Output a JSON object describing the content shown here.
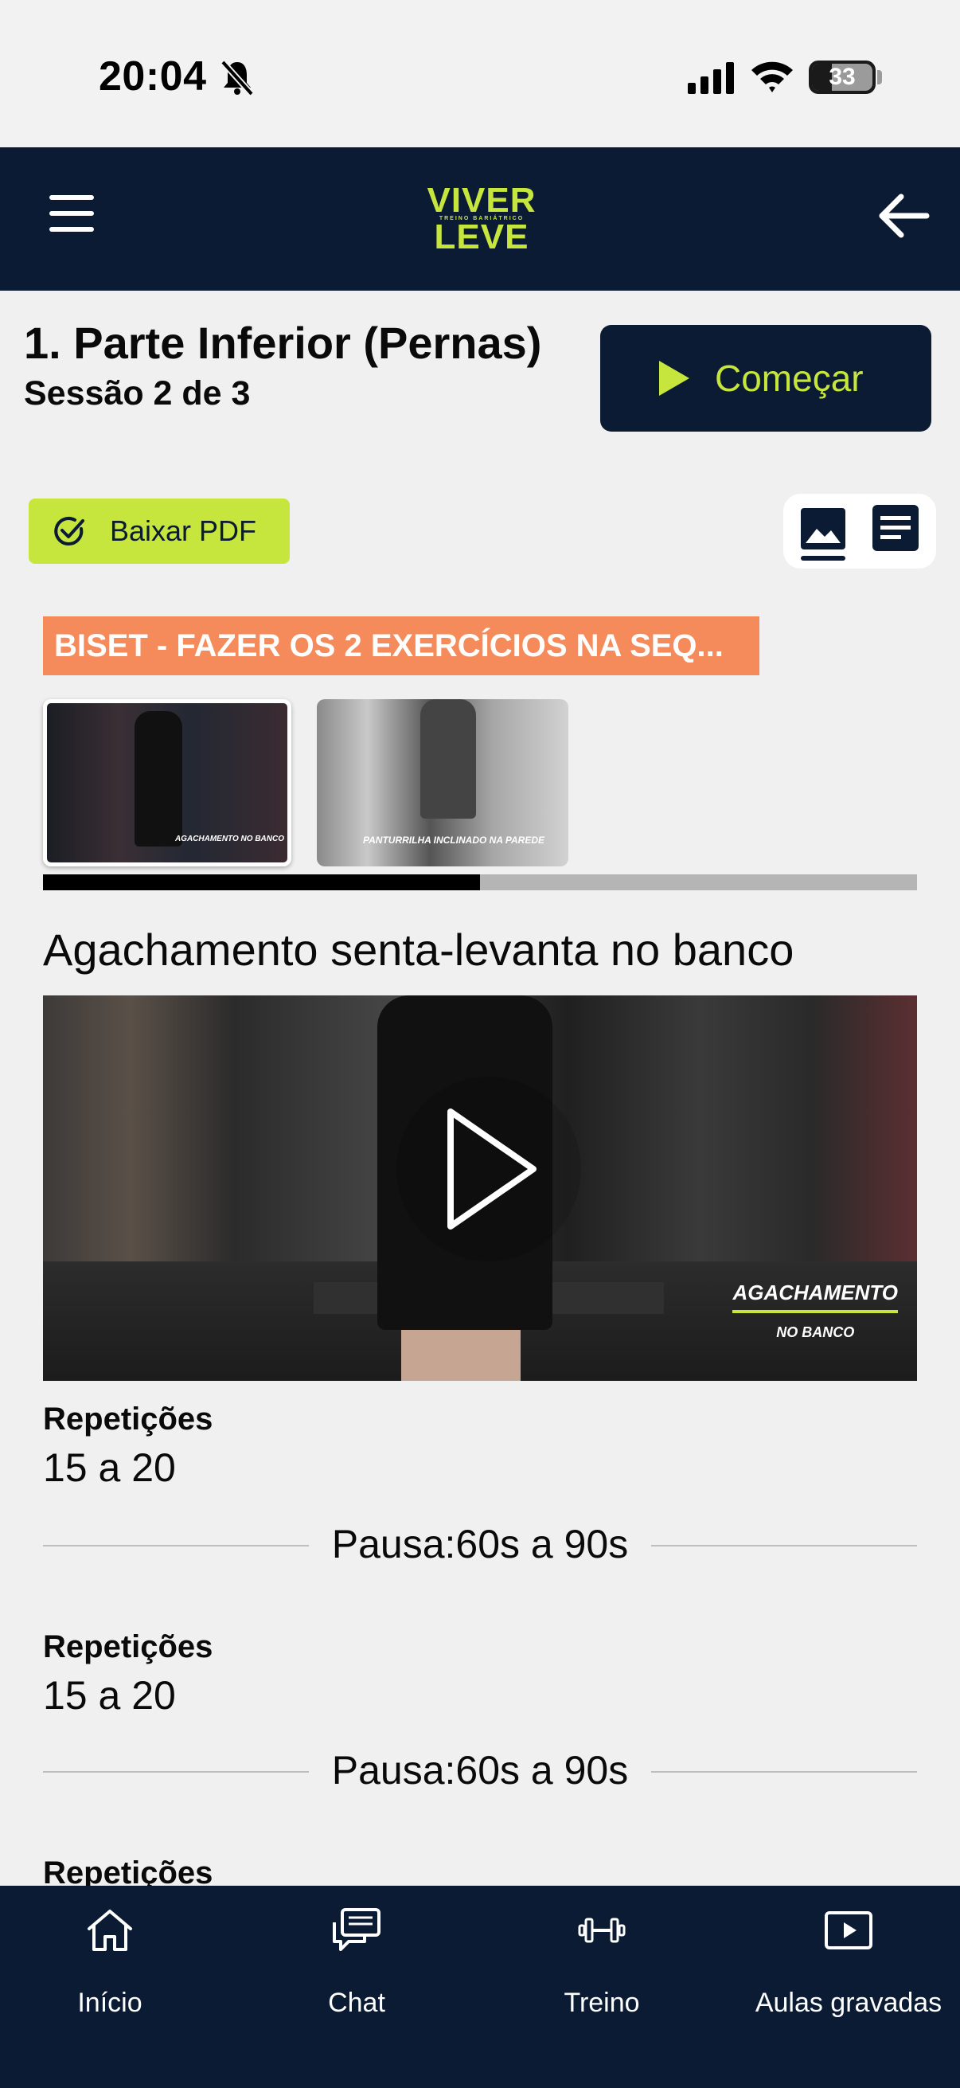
{
  "status_bar": {
    "time": "20:04",
    "battery": "33"
  },
  "header": {
    "logo_top": "VIVER",
    "logo_mid": "TREINO BARIÁTRICO",
    "logo_bottom": "LEVE"
  },
  "workout": {
    "title": "1. Parte Inferior (Pernas)",
    "subtitle": "Sessão 2 de 3",
    "start_label": "Começar",
    "pdf_label": "Baixar PDF",
    "biset_label": "BISET - FAZER OS 2 EXERCÍCIOS NA SEQ...",
    "thumbnails": [
      {
        "caption": "AGACHAMENTO NO BANCO"
      },
      {
        "caption": "PANTURRILHA INCLINADO NA PAREDE"
      }
    ],
    "carousel_progress": 0.5
  },
  "exercise": {
    "name": "Agachamento senta-levanta no banco",
    "video_caption_main": "AGACHAMENTO",
    "video_caption_sub": "NO BANCO",
    "sets": [
      {
        "label": "Repetições",
        "value": "15 a 20",
        "pause": "Pausa:60s a 90s"
      },
      {
        "label": "Repetições",
        "value": "15 a 20",
        "pause": "Pausa:60s a 90s"
      },
      {
        "label": "Repetições"
      }
    ]
  },
  "nav": [
    {
      "label": "Início",
      "icon": "home-icon"
    },
    {
      "label": "Chat",
      "icon": "chat-icon"
    },
    {
      "label": "Treino",
      "icon": "dumbbell-icon"
    },
    {
      "label": "Aulas gravadas",
      "icon": "video-play-icon"
    }
  ],
  "colors": {
    "navy": "#0b1b33",
    "lime": "#c6e53d",
    "orange": "#f58a5a"
  }
}
